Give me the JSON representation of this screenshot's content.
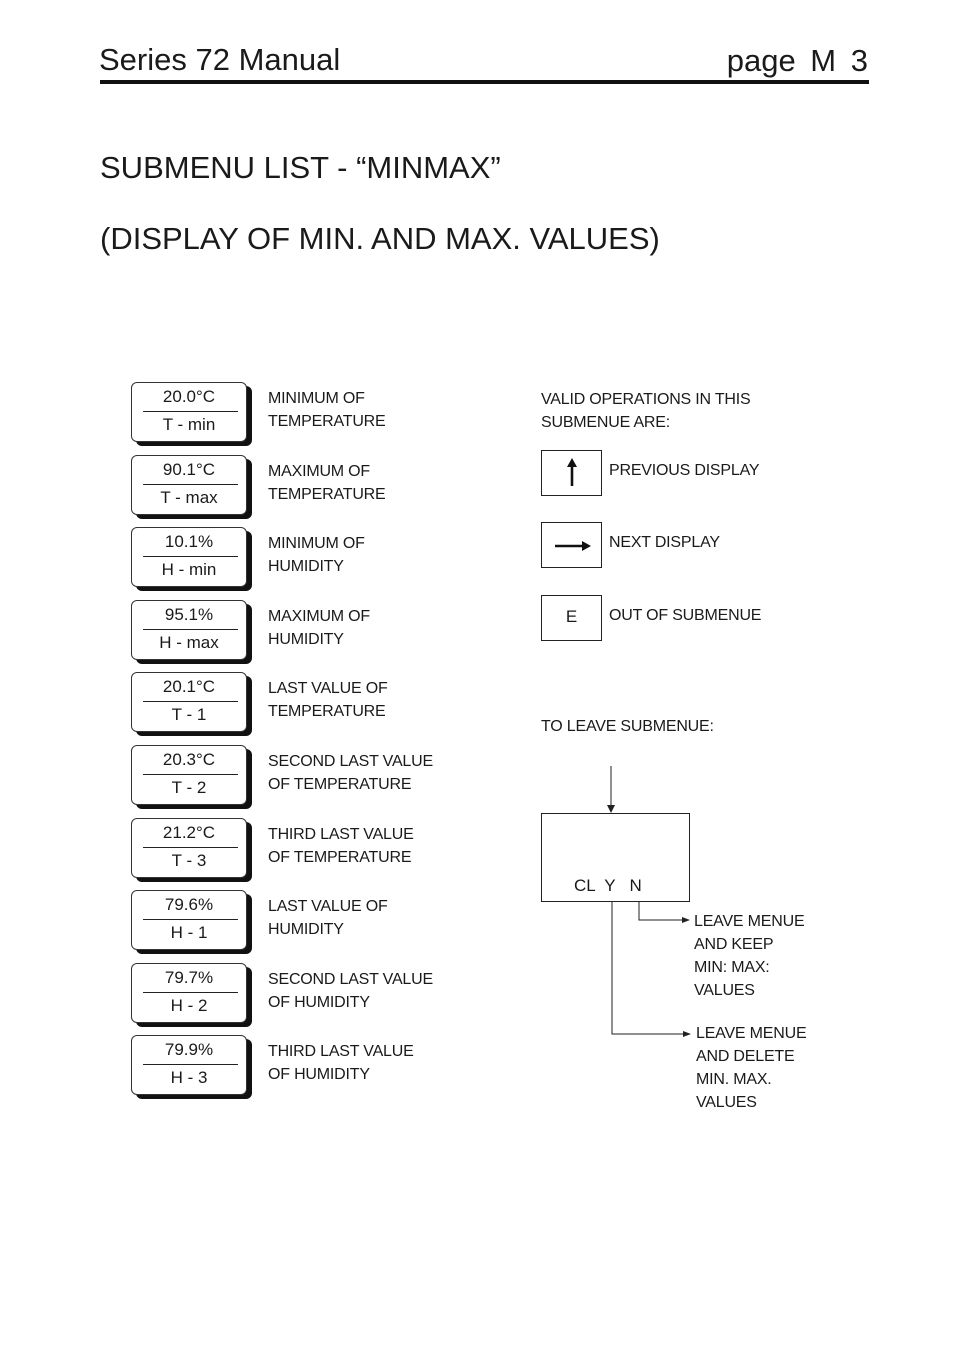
{
  "header": {
    "title": "Series 72 Manual",
    "page": "page  M 3"
  },
  "heading": {
    "line1": "SUBMENU LIST - “MINMAX”",
    "line2": "(DISPLAY OF MIN. AND MAX. VALUES)"
  },
  "displays": [
    {
      "value": "20.0°C",
      "label": "T - min",
      "desc1": "MINIMUM OF",
      "desc2": "TEMPERATURE"
    },
    {
      "value": "90.1°C",
      "label": "T - max",
      "desc1": "MAXIMUM OF",
      "desc2": "TEMPERATURE"
    },
    {
      "value": "10.1%",
      "label": "H - min",
      "desc1": "MINIMUM OF",
      "desc2": "HUMIDITY"
    },
    {
      "value": "95.1%",
      "label": "H - max",
      "desc1": "MAXIMUM OF",
      "desc2": "HUMIDITY"
    },
    {
      "value": "20.1°C",
      "label": "T - 1",
      "desc1": "LAST VALUE OF",
      "desc2": "TEMPERATURE"
    },
    {
      "value": "20.3°C",
      "label": "T - 2",
      "desc1": "SECOND LAST VALUE",
      "desc2": "OF TEMPERATURE"
    },
    {
      "value": "21.2°C",
      "label": "T - 3",
      "desc1": "THIRD LAST VALUE",
      "desc2": "OF TEMPERATURE"
    },
    {
      "value": "79.6%",
      "label": "H - 1",
      "desc1": "LAST VALUE OF",
      "desc2": "HUMIDITY"
    },
    {
      "value": "79.7%",
      "label": "H - 2",
      "desc1": "SECOND LAST VALUE",
      "desc2": "OF HUMIDITY"
    },
    {
      "value": "79.9%",
      "label": "H - 3",
      "desc1": "THIRD LAST VALUE",
      "desc2": "OF HUMIDITY"
    }
  ],
  "operations": {
    "intro1": "VALID OPERATIONS IN THIS",
    "intro2": "SUBMENUE ARE:",
    "keys": [
      {
        "icon": "arrow-up-icon",
        "symbol": "",
        "label": "PREVIOUS DISPLAY"
      },
      {
        "icon": "arrow-right-icon",
        "symbol": "",
        "label": "NEXT DISPLAY"
      },
      {
        "icon": "",
        "symbol": "E",
        "label": "OUT OF SUBMENUE"
      }
    ]
  },
  "leave": {
    "title": "TO LEAVE SUBMENUE:",
    "display_text": "CL  Y   N",
    "option_n": [
      "LEAVE MENUE",
      "AND KEEP",
      "MIN: MAX:",
      "VALUES"
    ],
    "option_y": [
      "LEAVE MENUE",
      "AND DELETE",
      "MIN. MAX.",
      "VALUES"
    ]
  }
}
